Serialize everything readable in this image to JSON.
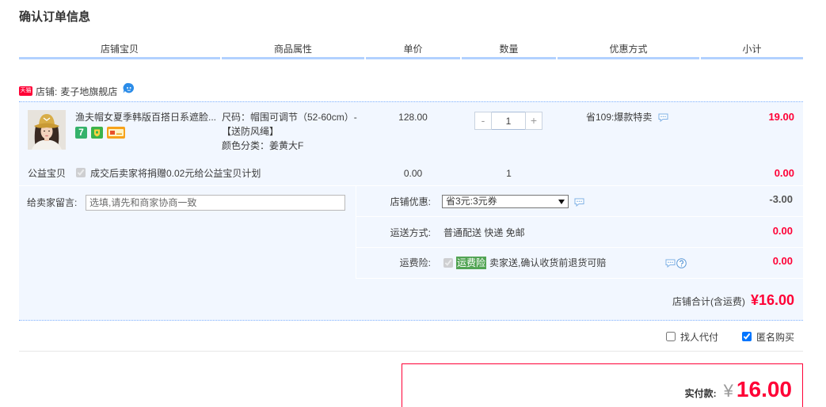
{
  "page_title": "确认订单信息",
  "columns": [
    "店铺宝贝",
    "商品属性",
    "单价",
    "数量",
    "优惠方式",
    "小计"
  ],
  "shop": {
    "badge": "天猫",
    "badge_icon": "tmall-badge-icon",
    "label": "店铺:",
    "name": "麦子地旗舰店",
    "chat_icon": "wangwang-chat-icon"
  },
  "item": {
    "thumbnail_icon": "product-thumbnail",
    "title": "渔夫帽女夏季韩版百搭日系遮脸...",
    "service_badges": [
      {
        "icon": "seven-day-return-icon",
        "text": "7"
      },
      {
        "icon": "consumer-guarantee-icon"
      },
      {
        "icon": "credit-card-icon"
      }
    ],
    "attributes": [
      "尺码：帽围可调节（52-60cm）-【送防风绳】",
      "颜色分类：姜黄大F"
    ],
    "unit_price": "128.00",
    "quantity": "1",
    "minus_label": "-",
    "plus_label": "+",
    "promotion": "省109:爆款特卖",
    "promotion_icon": "comment-icon",
    "subtotal": "19.00"
  },
  "charity": {
    "label": "公益宝贝",
    "checked": true,
    "disabled": true,
    "description": "成交后卖家将捐赠0.02元给公益宝贝计划",
    "unit_price": "0.00",
    "quantity": "1",
    "subtotal": "0.00"
  },
  "message": {
    "label": "给卖家留言:",
    "placeholder": "选填,请先和商家协商一致"
  },
  "shop_discount": {
    "label": "店铺优惠:",
    "selected": "省3元:3元券",
    "icon": "comment-icon",
    "amount": "-3.00"
  },
  "shipping": {
    "label": "运送方式:",
    "value": "普通配送 快递 免邮",
    "amount": "0.00"
  },
  "freight_insurance": {
    "label": "运费险:",
    "checked": true,
    "disabled": true,
    "tag": "运费险",
    "description": "卖家送,确认收货前退货可赔",
    "icons": [
      "comment-icon",
      "question-icon"
    ],
    "amount": "0.00"
  },
  "shop_total": {
    "label": "店铺合计(含运费)",
    "value": "¥16.00"
  },
  "options": [
    {
      "label": "找人代付",
      "checked": false
    },
    {
      "label": "匿名购买",
      "checked": true
    }
  ],
  "payment": {
    "label": "实付款:",
    "currency": "¥",
    "amount": "16.00"
  },
  "colors": {
    "price_red": "#ff0036",
    "header_line": "#b2d1ff",
    "block_bg": "#f2f7ff",
    "dotted_border": "#80b2ff",
    "insurance_tag": "#52a454"
  }
}
